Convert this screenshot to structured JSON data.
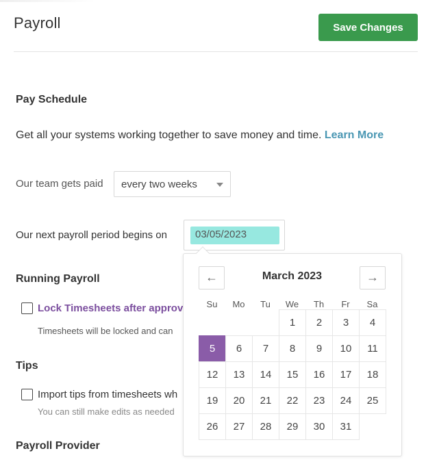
{
  "header": {
    "title": "Payroll",
    "save_label": "Save Changes"
  },
  "pay_schedule": {
    "title": "Pay Schedule",
    "intro": "Get all your systems working together to save money and time.",
    "learn_more": "Learn More",
    "frequency_label": "Our team gets paid",
    "frequency_value": "every two weeks",
    "next_period_label": "Our next payroll period begins on",
    "next_period_value": "03/05/2023"
  },
  "running_payroll": {
    "title": "Running Payroll",
    "lock_label": "Lock Timesheets after approva",
    "lock_help": "Timesheets will be locked and can"
  },
  "tips": {
    "title": "Tips",
    "import_label": "Import tips from timesheets wh",
    "import_help": "You can still make edits as needed"
  },
  "payroll_provider": {
    "title": "Payroll Provider"
  },
  "calendar": {
    "month_label": "March 2023",
    "prev_icon": "←",
    "next_icon": "→",
    "weekdays": [
      "Su",
      "Mo",
      "Tu",
      "We",
      "Th",
      "Fr",
      "Sa"
    ],
    "leading_blanks": 3,
    "days": [
      "1",
      "2",
      "3",
      "4",
      "5",
      "6",
      "7",
      "8",
      "9",
      "10",
      "11",
      "12",
      "13",
      "14",
      "15",
      "16",
      "17",
      "18",
      "19",
      "20",
      "21",
      "22",
      "23",
      "24",
      "25",
      "26",
      "27",
      "28",
      "29",
      "30",
      "31"
    ],
    "selected_day": "5"
  },
  "colors": {
    "accent_green": "#3a9a4d",
    "link_blue": "#4a97b3",
    "selected_purple": "#8a5ca8",
    "date_highlight": "#97e8e0"
  }
}
